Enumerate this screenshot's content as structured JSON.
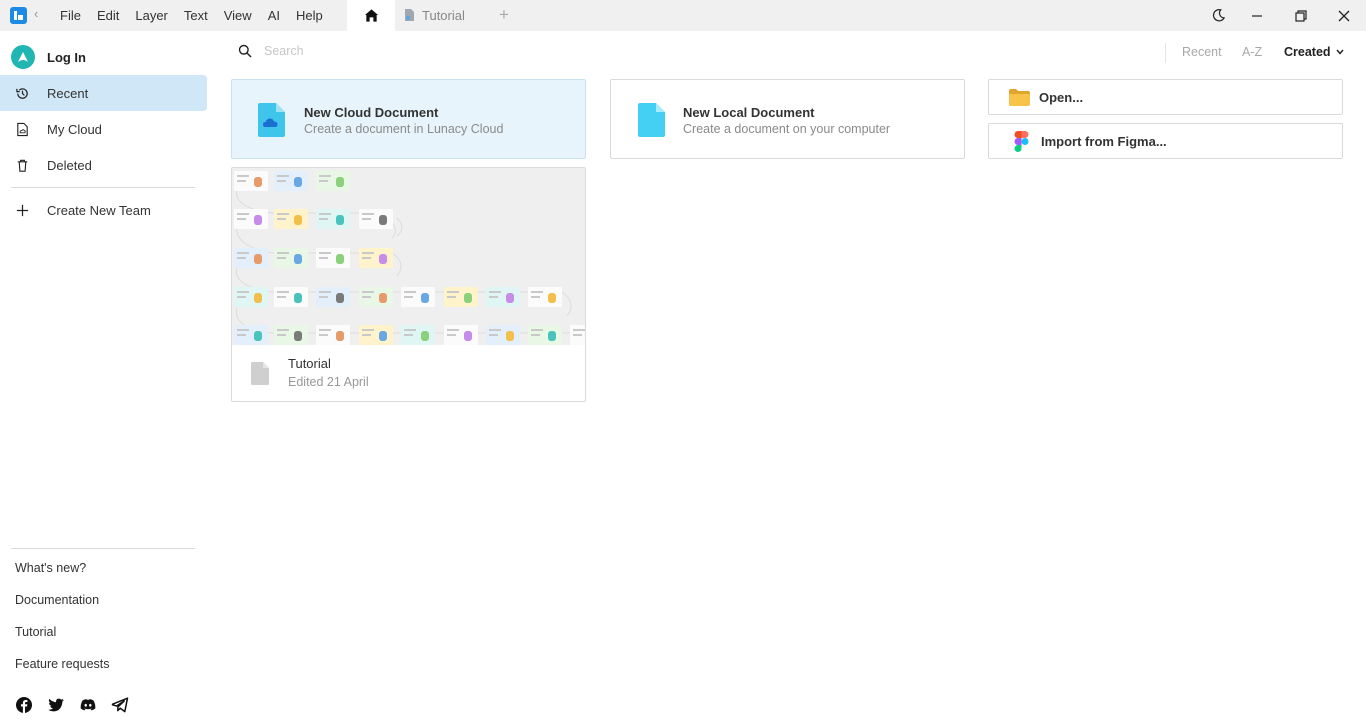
{
  "menu": [
    "File",
    "Edit",
    "Layer",
    "Text",
    "View",
    "AI",
    "Help"
  ],
  "tabs": {
    "doc_label": "Tutorial"
  },
  "sidebar": {
    "login": "Log In",
    "items": [
      {
        "label": "Recent",
        "active": true
      },
      {
        "label": "My Cloud",
        "active": false
      },
      {
        "label": "Deleted",
        "active": false
      }
    ],
    "create_team": "Create New Team",
    "footer_links": [
      "What's new?",
      "Documentation",
      "Tutorial",
      "Feature requests"
    ],
    "social": [
      "facebook-icon",
      "twitter-icon",
      "discord-icon",
      "telegram-icon"
    ]
  },
  "search": {
    "placeholder": "Search"
  },
  "sort": {
    "options": [
      "Recent",
      "A-Z",
      "Created"
    ],
    "selected": "Created"
  },
  "cards": {
    "cloud": {
      "title": "New Cloud Document",
      "subtitle": "Create a document in Lunacy Cloud"
    },
    "local": {
      "title": "New Local Document",
      "subtitle": "Create a document on your computer"
    },
    "open": "Open...",
    "figma": "Import from Figma..."
  },
  "documents": [
    {
      "title": "Tutorial",
      "edited": "Edited 21 April"
    }
  ],
  "colors": {
    "accent": "#1d8be6",
    "active_nav": "#cfe7f6",
    "cloud_card": "#e7f4fb",
    "brand_teal": "#22b6b3"
  }
}
